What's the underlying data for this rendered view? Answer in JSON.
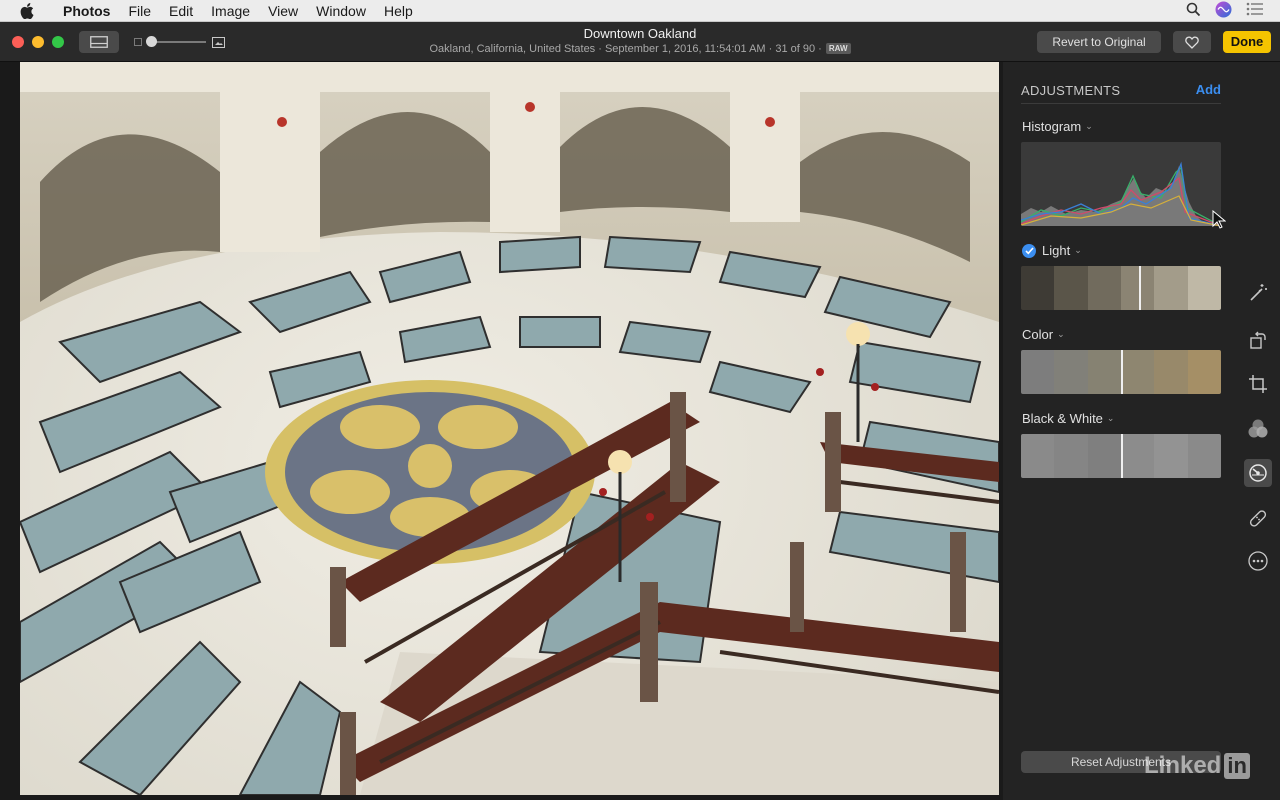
{
  "menubar": {
    "app_name": "Photos",
    "items": [
      "File",
      "Edit",
      "Image",
      "View",
      "Window",
      "Help"
    ],
    "icons": [
      "apple-icon",
      "search-icon",
      "siri-icon",
      "notification-center-icon"
    ]
  },
  "toolbar": {
    "title": "Downtown Oakland",
    "subtitle": "Oakland, California, United States  ·  September 1, 2016, 11:54:01 AM  ·  31 of 90  ·",
    "raw_badge": "RAW",
    "revert_label": "Revert to Original",
    "done_label": "Done",
    "zoom_level": 0
  },
  "photo": {
    "description_icon": "photo-rotunda"
  },
  "adjustments": {
    "title": "ADJUSTMENTS",
    "add_label": "Add",
    "histogram_label": "Histogram",
    "light_label": "Light",
    "light_enabled": true,
    "color_label": "Color",
    "bw_label": "Black & White",
    "reset_label": "Reset Adjustments"
  },
  "tools": [
    "enhance-icon",
    "rotate-icon",
    "crop-icon",
    "filters-icon",
    "adjust-icon",
    "retouch-icon",
    "more-icon"
  ],
  "watermark": {
    "text": "Linked",
    "badge": "in"
  },
  "colors": {
    "accent": "#3b8ef0",
    "done": "#f5c400"
  }
}
